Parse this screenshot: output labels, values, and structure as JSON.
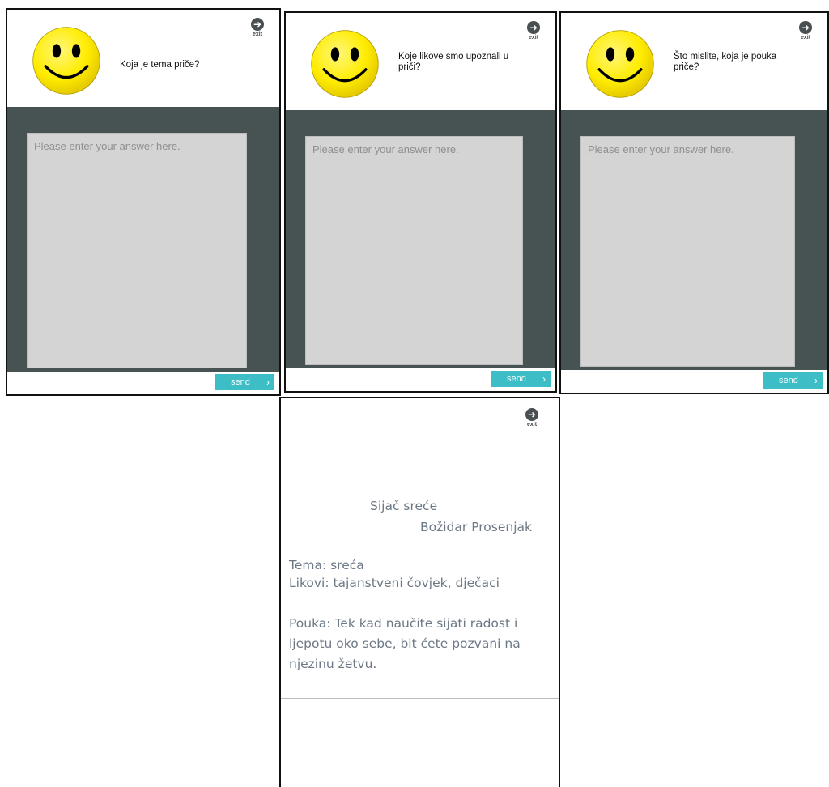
{
  "panels": [
    {
      "question": "Koja je tema priče?",
      "placeholder": "Please enter your answer here.",
      "exit_label": "exit",
      "send_label": "send"
    },
    {
      "question": "Koje likove smo upoznali u priči?",
      "placeholder": "Please enter your answer here.",
      "exit_label": "exit",
      "send_label": "send"
    },
    {
      "question": "Što mislite, koja je pouka priče?",
      "placeholder": "Please enter your answer here.",
      "exit_label": "exit",
      "send_label": "send"
    }
  ],
  "summary": {
    "exit_label": "exit",
    "title": "Sijač sreće",
    "author": "Božidar Prosenjak",
    "tema": "Tema: sreća",
    "likovi": "Likovi: tajanstveni čovjek, dječaci",
    "pouka": "Pouka: Tek kad naučite sijati radost i ljepotu oko sebe, bit ćete pozvani na njezinu žetvu."
  },
  "icons": {
    "smiley": "smiley-face-icon",
    "exit": "arrow-right-circle-icon",
    "send": "chevron-right-icon"
  },
  "colors": {
    "body_bg": "#475252",
    "answer_bg": "#d4d4d4",
    "send_bg": "#3dbdc6",
    "smiley_fill": "#ffec00",
    "summary_text": "#6c7886"
  }
}
